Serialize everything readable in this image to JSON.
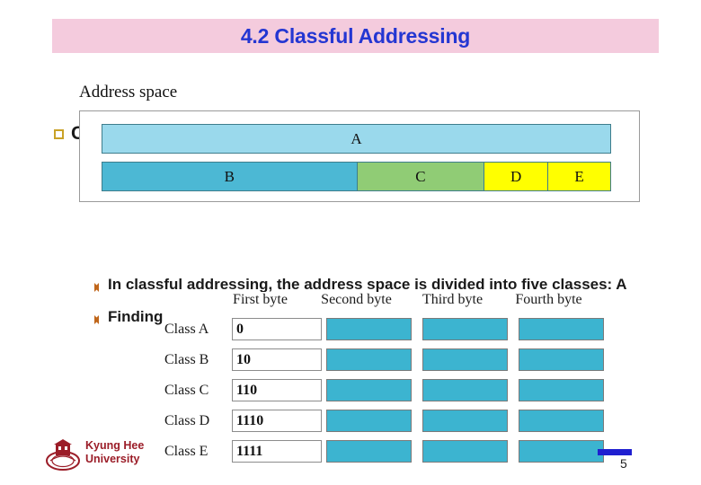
{
  "slide": {
    "title": "4.2 Classful Addressing",
    "title_bg_color": "#f4cbdd",
    "title_color": "#2436d2",
    "page_number": "5"
  },
  "outline_bullet": {
    "marker": "square-bullet-icon",
    "text": "C"
  },
  "address_space_figure": {
    "caption": "Address space",
    "row1": [
      {
        "label": "A",
        "color": "#9ad9ec",
        "width_pct": 100
      }
    ],
    "row2": [
      {
        "label": "B",
        "color": "#4cb8d4",
        "width_pct": 50
      },
      {
        "label": "C",
        "color": "#90cc75",
        "width_pct": 25
      },
      {
        "label": "D",
        "color": "#ffff00",
        "width_pct": 12.5
      },
      {
        "label": "E",
        "color": "#ffff00",
        "width_pct": 12.5
      }
    ]
  },
  "body_lines": [
    {
      "bullet": "diamond-bullet-icon",
      "text": "In classful addressing, the address space is divided into five classes: A"
    },
    {
      "bullet": "diamond-bullet-icon",
      "text": "Finding t"
    }
  ],
  "class_figure": {
    "column_headers": [
      "First byte",
      "Second byte",
      "Third byte",
      "Fourth byte"
    ],
    "rows": [
      {
        "label": "Class A",
        "first_byte": "0",
        "fill_color": "#3cb4d0"
      },
      {
        "label": "Class B",
        "first_byte": "10",
        "fill_color": "#3cb4d0"
      },
      {
        "label": "Class C",
        "first_byte": "110",
        "fill_color": "#3cb4d0"
      },
      {
        "label": "Class D",
        "first_byte": "1110",
        "fill_color": "#3cb4d0"
      },
      {
        "label": "Class E",
        "first_byte": "1111",
        "fill_color": "#3cb4d0"
      }
    ]
  },
  "footer": {
    "logo": "kyung-hee-crest-icon",
    "university_line1": "Kyung Hee",
    "university_line2": "University",
    "accent_color": "#9b1d28",
    "rule_color": "#1f1fd0"
  }
}
